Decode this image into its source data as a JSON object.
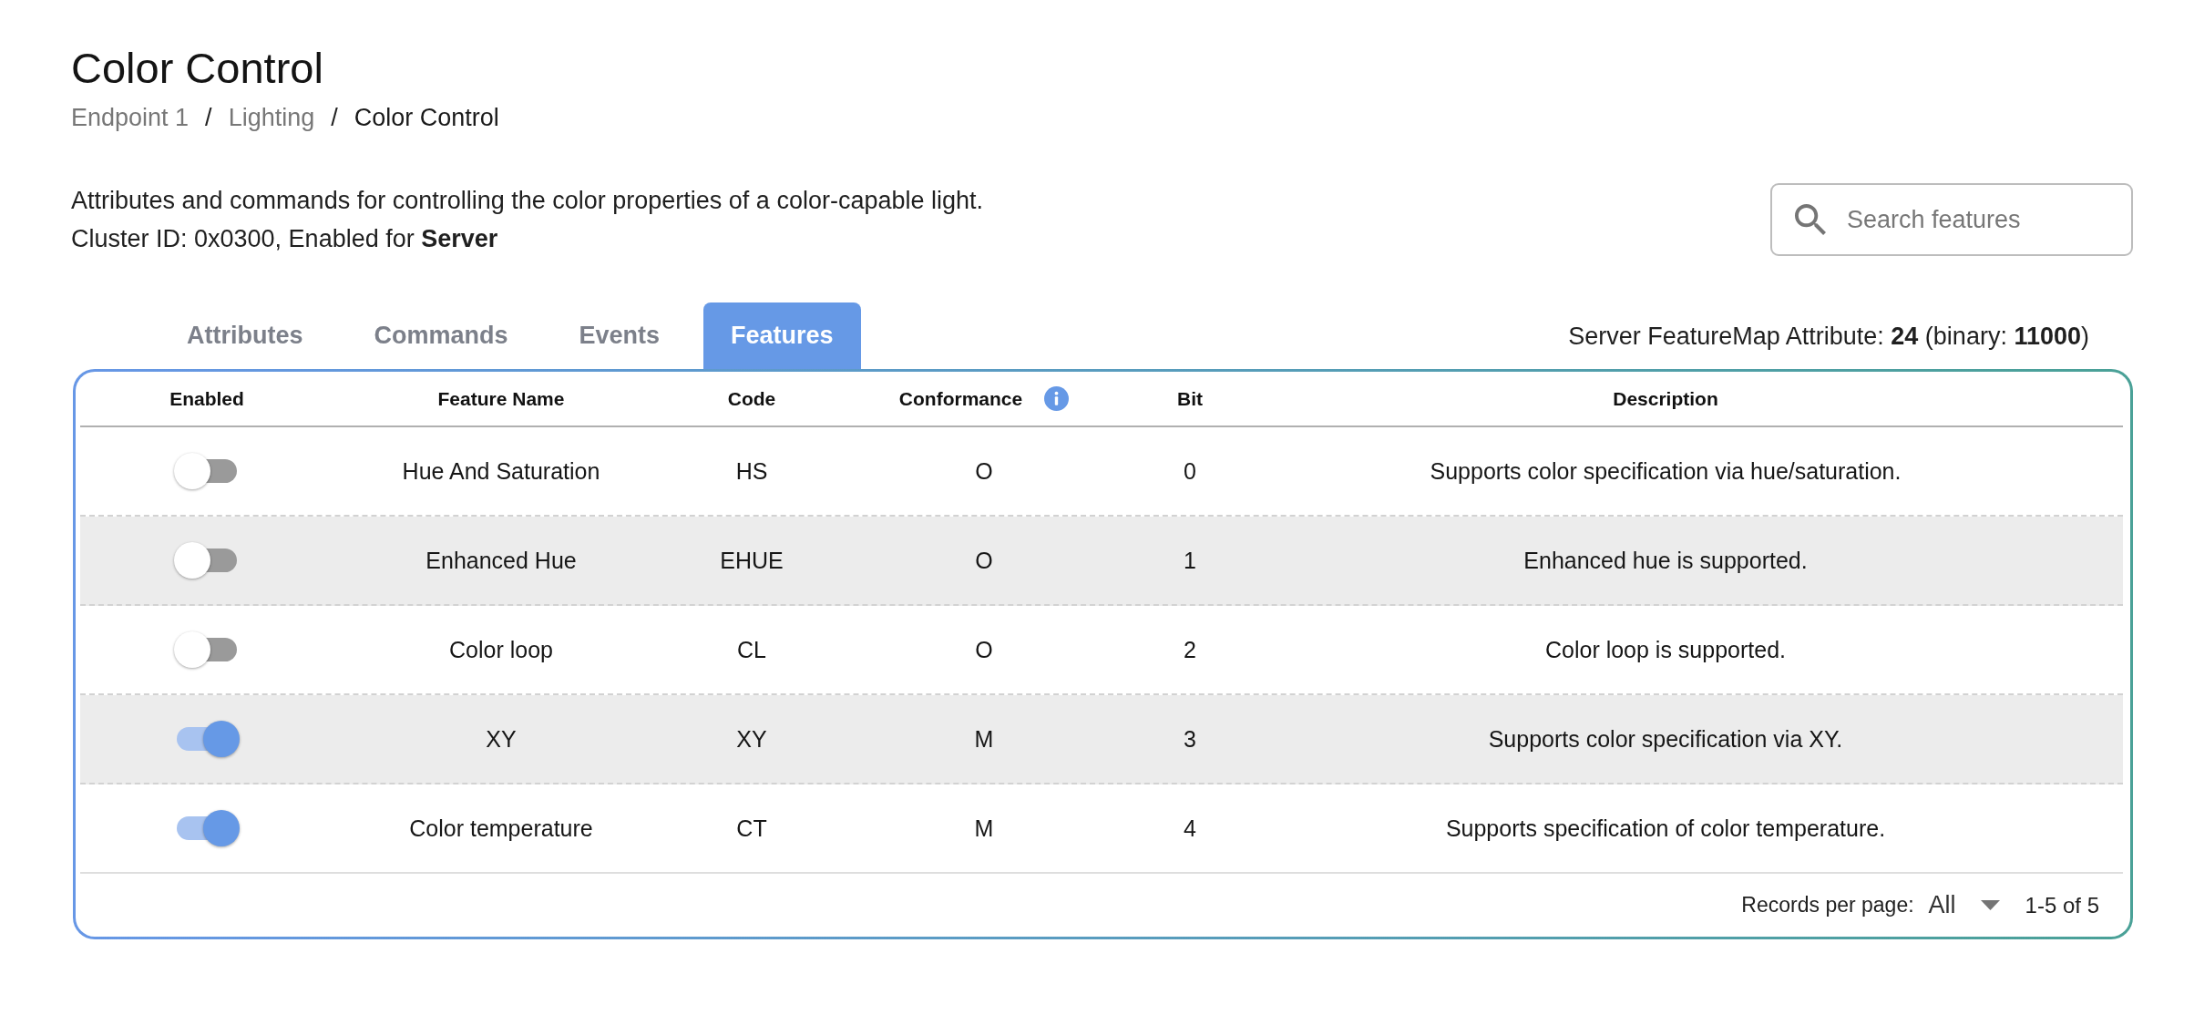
{
  "title": "Color Control",
  "breadcrumb": [
    {
      "kind": "link",
      "text": "Endpoint 1"
    },
    {
      "kind": "separator",
      "text": "/"
    },
    {
      "kind": "link",
      "text": "Lighting"
    },
    {
      "kind": "separator",
      "text": "/"
    },
    {
      "kind": "current",
      "text": "Color Control"
    }
  ],
  "description": "Attributes and commands for controlling the color properties of a color-capable light.",
  "cluster_info": "Cluster ID: 0x0300, Enabled for **Server**",
  "search": {
    "placeholder": "Search features"
  },
  "tabs": [
    {
      "label": "Attributes",
      "selected": false
    },
    {
      "label": "Commands",
      "selected": false
    },
    {
      "label": "Events",
      "selected": false
    },
    {
      "label": "Features",
      "selected": true
    }
  ],
  "feature_map": "Server FeatureMap Attribute: **24** (binary: **11000**)",
  "table": {
    "columns": [
      {
        "label": "Enabled",
        "info": false
      },
      {
        "label": "Feature Name",
        "info": false
      },
      {
        "label": "Code",
        "info": false
      },
      {
        "label": "Conformance",
        "info": true
      },
      {
        "label": "Bit",
        "info": false
      },
      {
        "label": "Description",
        "info": false
      }
    ],
    "rows": [
      {
        "enabled": false,
        "name": "Hue And Saturation",
        "code": "HS",
        "conformance": "O",
        "bit": "0",
        "description": "Supports color specification via hue/saturation."
      },
      {
        "enabled": false,
        "name": "Enhanced Hue",
        "code": "EHUE",
        "conformance": "O",
        "bit": "1",
        "description": "Enhanced hue is supported."
      },
      {
        "enabled": false,
        "name": "Color loop",
        "code": "CL",
        "conformance": "O",
        "bit": "2",
        "description": "Color loop is supported."
      },
      {
        "enabled": true,
        "name": "XY",
        "code": "XY",
        "conformance": "M",
        "bit": "3",
        "description": "Supports color specification via XY."
      },
      {
        "enabled": true,
        "name": "Color temperature",
        "code": "CT",
        "conformance": "M",
        "bit": "4",
        "description": "Supports specification of color temperature."
      }
    ]
  },
  "pagination": {
    "label": "Records per page:",
    "value": "All",
    "range": "1-5 of 5"
  }
}
